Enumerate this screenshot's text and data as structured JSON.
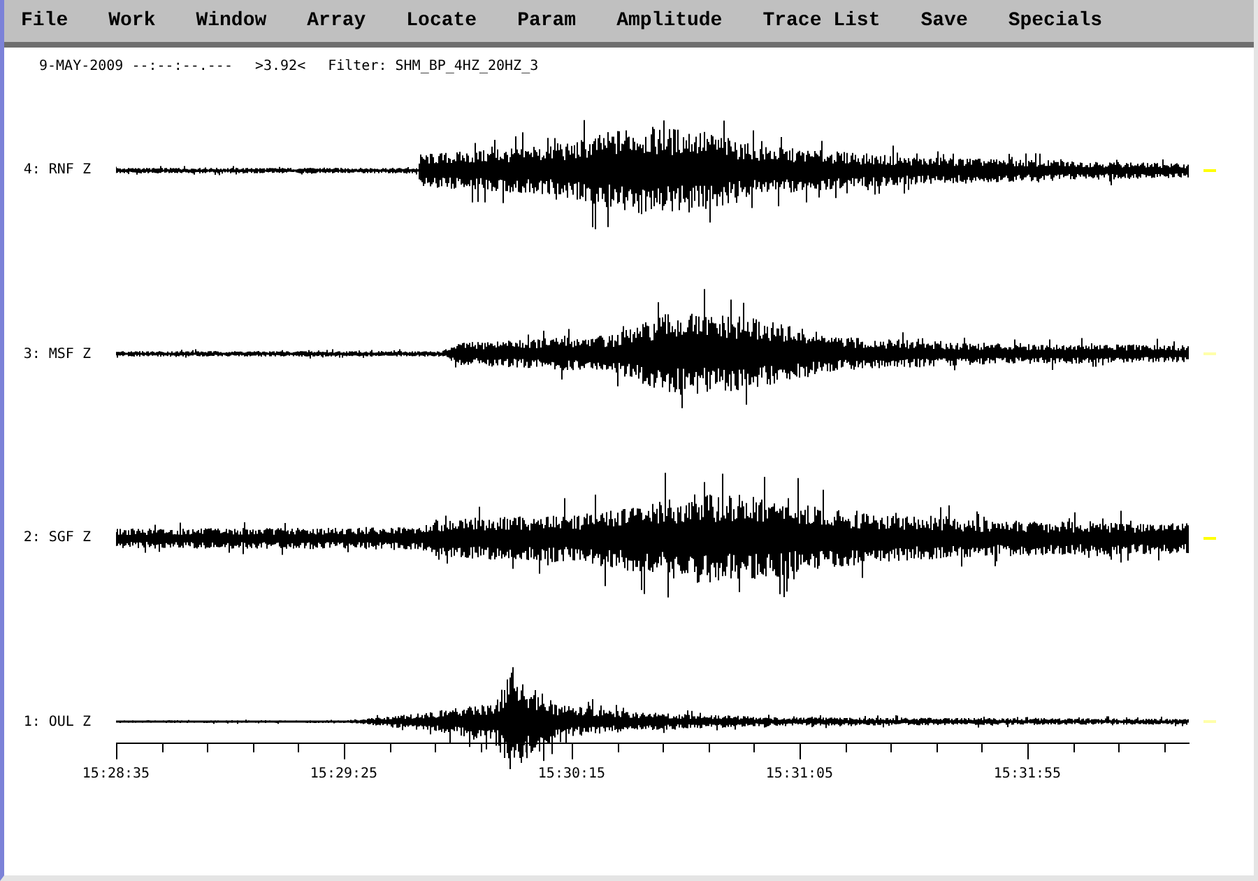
{
  "menu": [
    "File",
    "Work",
    "Window",
    "Array",
    "Locate",
    "Param",
    "Amplitude",
    "Trace List",
    "Save",
    "Specials"
  ],
  "header": {
    "date": "9-MAY-2009",
    "time": "--:--:--.---",
    "zoom": ">3.92<",
    "filter": "Filter: SHM_BP_4HZ_20HZ_3"
  },
  "traces": [
    {
      "label": "4: RNF Z",
      "marked": true
    },
    {
      "label": "3: MSF Z",
      "marked": false
    },
    {
      "label": "2: SGF Z",
      "marked": true
    },
    {
      "label": "1: OUL Z",
      "marked": false
    }
  ],
  "time_axis": {
    "labels": [
      "15:28:35",
      "15:29:25",
      "15:30:15",
      "15:31:05",
      "15:31:55"
    ]
  }
}
